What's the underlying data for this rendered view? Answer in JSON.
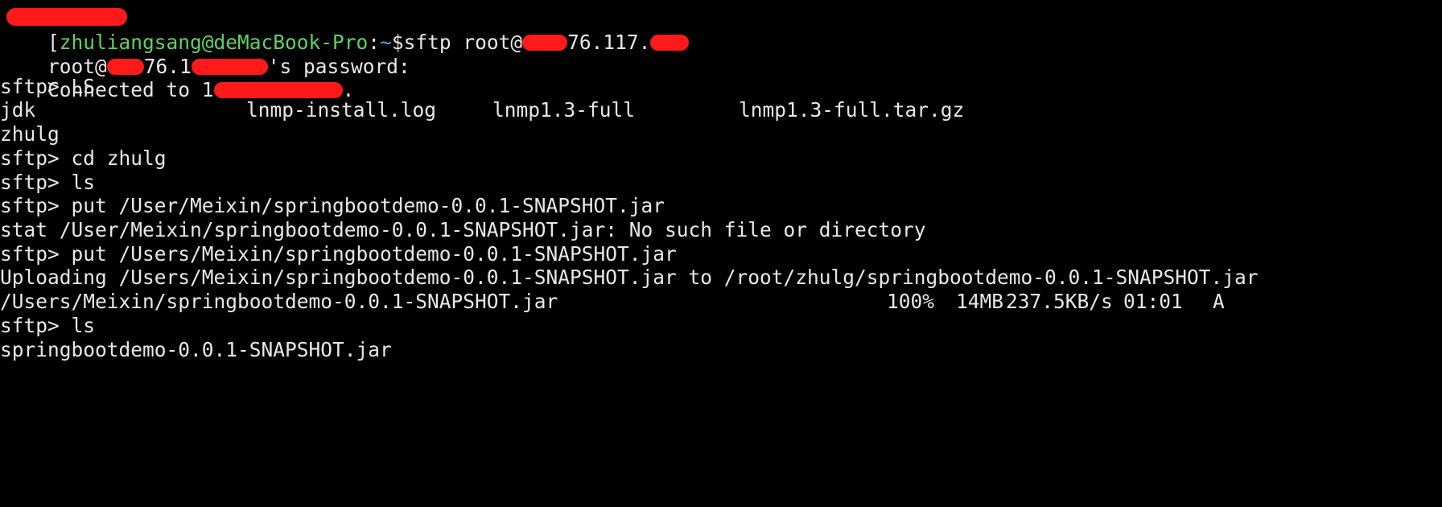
{
  "colors": {
    "background": "#000000",
    "text": "#e8e8e8",
    "prompt_user": "#5fd35f",
    "prompt_path": "#48b4d4",
    "redaction": "#ff1a1a"
  },
  "line1": {
    "bracket": "[",
    "user_host": "zhuliangsang@deMacBook-Pro",
    "colon": ":",
    "path": "~",
    "command": "$sftp root@",
    "ip_mid": "76.117."
  },
  "line2": {
    "prefix": "root@",
    "mid": "76.1",
    "suffix": "'s password:"
  },
  "line3": {
    "prefix": "Connected to 1",
    "suffix": "."
  },
  "line4": "sftp> LS",
  "listing1": {
    "files": [
      "jdk",
      "lnmp-install.log",
      "lnmp1.3-full",
      "lnmp1.3-full.tar.gz"
    ]
  },
  "line6": "zhulg",
  "line7": "sftp> cd zhulg",
  "line8": "sftp> ls",
  "line9": "sftp> put /User/Meixin/springbootdemo-0.0.1-SNAPSHOT.jar",
  "line10": "stat /User/Meixin/springbootdemo-0.0.1-SNAPSHOT.jar: No such file or directory",
  "line11": "sftp> put /Users/Meixin/springbootdemo-0.0.1-SNAPSHOT.jar",
  "line12": "Uploading /Users/Meixin/springbootdemo-0.0.1-SNAPSHOT.jar to /root/zhulg/springbootdemo-0.0.1-SNAPSHOT.jar",
  "progress": {
    "file": "/Users/Meixin/springbootdemo-0.0.1-SNAPSHOT.jar",
    "percent": "100%",
    "size": "14MB",
    "rate": "237.5KB/s",
    "time": "01:01",
    "flag": "A"
  },
  "line14": "sftp> ls",
  "line15": "springbootdemo-0.0.1-SNAPSHOT.jar"
}
